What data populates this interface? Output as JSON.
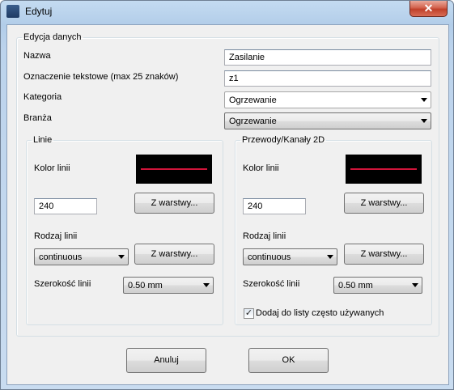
{
  "window": {
    "title": "Edytuj",
    "close_glyph": "✕"
  },
  "form": {
    "group_title": "Edycja danych",
    "fields": {
      "name_label": "Nazwa",
      "name_value": "Zasilanie",
      "code_label": "Oznaczenie tekstowe (max 25 znaków)",
      "code_value": "z1",
      "category_label": "Kategoria",
      "category_value": "Ogrzewanie",
      "branch_label": "Branża",
      "branch_value": "Ogrzewanie"
    },
    "lines": {
      "title": "Linie",
      "color_label": "Kolor linii",
      "line_color": "#d0143a",
      "color_value": "240",
      "from_layer_button": "Z warstwy...",
      "type_label": "Rodzaj linii",
      "type_value": "continuous",
      "type_from_layer_button": "Z warstwy...",
      "width_label": "Szerokość linii",
      "width_value": "0.50 mm"
    },
    "ducts": {
      "title": "Przewody/Kanały 2D",
      "color_label": "Kolor linii",
      "line_color": "#d0143a",
      "color_value": "240",
      "from_layer_button": "Z warstwy...",
      "type_label": "Rodzaj linii",
      "type_value": "continuous",
      "type_from_layer_button": "Z warstwy...",
      "width_label": "Szerokość linii",
      "width_value": "0.50 mm",
      "frequent_checkbox_label": "Dodaj do listy często używanych",
      "frequent_checked": true
    }
  },
  "buttons": {
    "cancel": "Anuluj",
    "ok": "OK"
  }
}
